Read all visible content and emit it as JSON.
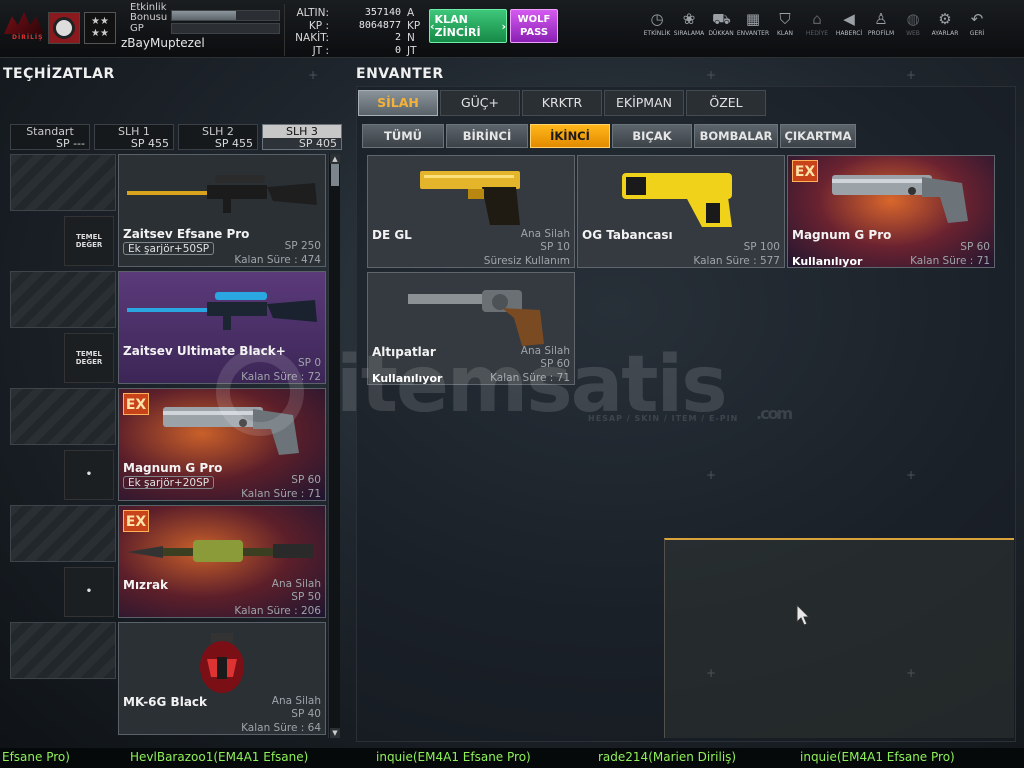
{
  "player": {
    "bonus_label": "Etkinlik Bonusu",
    "bonus_progress": 0.6,
    "gp_label": "GP",
    "gp_progress": 0.0,
    "username": "zBayMuptezel"
  },
  "currency": [
    {
      "label": "ALTIN:",
      "value": "357140",
      "unit": "A"
    },
    {
      "label": "KP :",
      "value": "8064877",
      "unit": "KP"
    },
    {
      "label": "NAKİT:",
      "value": "2",
      "unit": "N"
    },
    {
      "label": "JT :",
      "value": "0",
      "unit": "JT"
    }
  ],
  "buttons": {
    "klan_zinciri": "KLAN ZİNCİRİ",
    "wolf_pass": "WOLF PASS"
  },
  "nav": [
    {
      "label": "ETKİNLİK",
      "icon": "clock-icon",
      "dim": false
    },
    {
      "label": "SIRALAMA",
      "icon": "medal-icon",
      "dim": false
    },
    {
      "label": "DÜKKAN",
      "icon": "cart-icon",
      "dim": false
    },
    {
      "label": "ENVANTER",
      "icon": "inventory-icon",
      "dim": false
    },
    {
      "label": "KLAN",
      "icon": "shield-icon",
      "dim": false
    },
    {
      "label": "HEDİYE",
      "icon": "gift-icon",
      "dim": true
    },
    {
      "label": "HABERCİ",
      "icon": "megaphone-icon",
      "dim": false
    },
    {
      "label": "PROFİLM",
      "icon": "profile-icon",
      "dim": false
    },
    {
      "label": "WEB",
      "icon": "globe-icon",
      "dim": true
    },
    {
      "label": "AYARLAR",
      "icon": "gear-icon",
      "dim": false
    },
    {
      "label": "GERİ",
      "icon": "back-icon",
      "dim": false
    }
  ],
  "left": {
    "title": "TEÇHİZATLAR",
    "slots": [
      {
        "name": "Standart",
        "sp": "SP ---",
        "active": false
      },
      {
        "name": "SLH 1",
        "sp": "SP 455",
        "active": false
      },
      {
        "name": "SLH 2",
        "sp": "SP 455",
        "active": false
      },
      {
        "name": "SLH 3",
        "sp": "SP 405",
        "active": true
      }
    ],
    "equipment": [
      {
        "mini": "TEMEL DEĞER",
        "name": "Zaitsev Efsane Pro",
        "cat": "",
        "sp": "SP 250",
        "ek": "Ek şarjör+50SP",
        "kalan": "Kalan Süre : 474",
        "style": "gray",
        "ex": false,
        "art": "sniper-gold"
      },
      {
        "mini": "TEMEL DEĞER",
        "name": "Zaitsev Ultimate Black+",
        "cat": "",
        "sp": "SP 0",
        "ek": "",
        "kalan": "Kalan Süre : 72",
        "style": "purple",
        "ex": false,
        "art": "sniper-blue"
      },
      {
        "mini": "•",
        "name": "Magnum G Pro",
        "cat": "",
        "sp": "SP 60",
        "ek": "Ek şarjör+20SP",
        "kalan": "Kalan Süre : 71",
        "style": "fire",
        "ex": true,
        "art": "revolver-silver"
      },
      {
        "mini": "•",
        "name": "Mızrak",
        "cat": "Ana Silah",
        "sp": "SP 50",
        "ek": "",
        "kalan": "Kalan Süre : 206",
        "style": "fire",
        "ex": true,
        "art": "spear"
      },
      {
        "mini": "",
        "name": "MK-6G Black",
        "cat": "Ana Silah",
        "sp": "SP 40",
        "ek": "",
        "kalan": "Kalan Süre : 64",
        "style": "gray",
        "ex": false,
        "art": "grenade"
      }
    ]
  },
  "right": {
    "title": "ENVANTER",
    "tabs": [
      {
        "label": "SİLAH",
        "active": true
      },
      {
        "label": "GÜÇ+",
        "active": false
      },
      {
        "label": "KRKTR",
        "active": false
      },
      {
        "label": "EKİPMAN",
        "active": false
      },
      {
        "label": "ÖZEL",
        "active": false
      }
    ],
    "subtabs": [
      {
        "label": "TÜMÜ",
        "active": false
      },
      {
        "label": "BİRİNCİ",
        "active": false
      },
      {
        "label": "İKİNCİ",
        "active": true
      },
      {
        "label": "BIÇAK",
        "active": false
      },
      {
        "label": "BOMBALAR",
        "active": false
      },
      {
        "label": "ÇIKARTMA",
        "active": false
      }
    ],
    "items": [
      {
        "name": "DE GL",
        "cat": "Ana Silah",
        "sp": "SP 10",
        "kalan": "Süresiz Kullanım",
        "using": "",
        "style": "gray",
        "ex": false,
        "art": "pistol-gold"
      },
      {
        "name": "OG Tabancası",
        "cat": "",
        "sp": "SP 100",
        "kalan": "Kalan Süre : 577",
        "using": "",
        "style": "gray",
        "ex": false,
        "art": "taser"
      },
      {
        "name": "Magnum G Pro",
        "cat": "",
        "sp": "SP 60",
        "kalan": "Kalan Süre : 71",
        "using": "Kullanılıyor",
        "style": "fire",
        "ex": true,
        "art": "revolver-silver"
      },
      {
        "name": "Altıpatlar",
        "cat": "Ana Silah",
        "sp": "SP 60",
        "kalan": "Kalan Süre : 71",
        "using": "Kullanılıyor",
        "style": "gray",
        "ex": false,
        "art": "revolver-wood"
      }
    ]
  },
  "ex_label": "EX",
  "watermark": {
    "word": "itemsatis",
    "com": ".com",
    "tag": "HESAP / SKIN / ITEM / E-PIN"
  },
  "ticker": [
    "Efsane Pro)",
    "HevlBarazoo1(EM4A1 Efsane)",
    "inquie(EM4A1 Efsane Pro)",
    "rade214(Marien Diriliş)",
    "inquie(EM4A1 Efsane Pro)"
  ],
  "colors": {
    "accent_orange": "#ffb71a",
    "ticker_green": "#8ff05a",
    "klan_green": "#168a47",
    "wolf_purple": "#8a1fb4"
  }
}
